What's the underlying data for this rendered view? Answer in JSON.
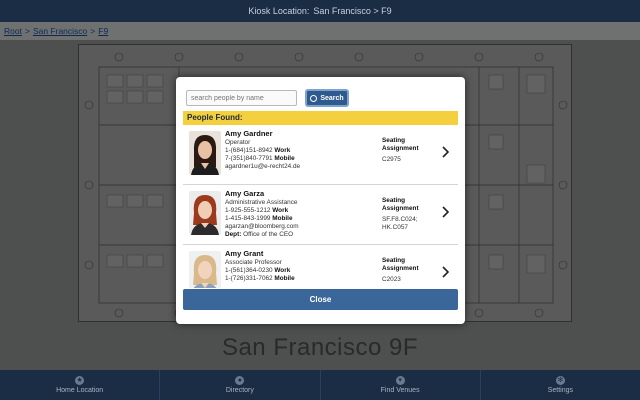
{
  "header": {
    "kiosk_label": "Kiosk Location:",
    "kiosk_value": "San Francisco > F9"
  },
  "breadcrumb": {
    "root": "Root",
    "sep1": ">",
    "city": "San Francisco",
    "sep2": ">",
    "floor": "F9"
  },
  "floor_title": "San Francisco 9F",
  "modal": {
    "search_placeholder": "search people by name",
    "search_label": "Search",
    "found_label": "People Found:",
    "close_label": "Close",
    "people": [
      {
        "name": "Amy Gardner",
        "title": "Operator",
        "phone1": "1-(684)151-8942",
        "phone1_type": "Work",
        "phone2": "7-(351)840-7791",
        "phone2_type": "Mobile",
        "email": "agardner1u@e-recht24.de",
        "seat_label": "Seating Assignment",
        "seat_value": "C2975"
      },
      {
        "name": "Amy Garza",
        "title": "Administrative Assistance",
        "phone1": "1-925-555-1212",
        "phone1_type": "Work",
        "phone2": "1-415-843-1999",
        "phone2_type": "Mobile",
        "email": "agarzan@bloomberg.com",
        "dept_label": "Dept:",
        "dept_value": "Office of the CEO",
        "seat_label": "Seating Assignment",
        "seat_value": "SF.F8.C024; HK.C057"
      },
      {
        "name": "Amy Grant",
        "title": "Associate Professor",
        "phone1": "1-(561)364-0230",
        "phone1_type": "Work",
        "phone2": "1-(726)331-7062",
        "phone2_type": "Mobile",
        "seat_label": "Seating Assignment",
        "seat_value": "C2023"
      }
    ]
  },
  "nav": {
    "items": [
      {
        "label": "Home Location",
        "icon": "star-icon"
      },
      {
        "label": "Directory",
        "icon": "person-icon"
      },
      {
        "label": "Find Venues",
        "icon": "map-pin-icon"
      },
      {
        "label": "Settings",
        "icon": "gear-icon"
      }
    ]
  },
  "colors": {
    "header_bg": "#1b2d45",
    "accent_blue": "#3a6699",
    "found_yellow": "#f4d03f"
  }
}
